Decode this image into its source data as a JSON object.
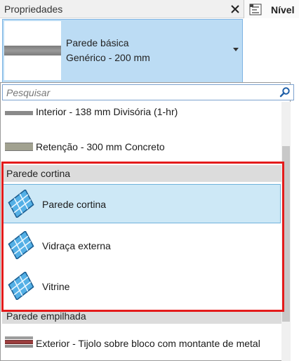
{
  "panel": {
    "title": "Propriedades",
    "close_icon": "close-icon"
  },
  "right_panel": {
    "label": "Nível",
    "icon": "level-icon"
  },
  "type_selector": {
    "family": "Parede básica",
    "type": "Genérico - 200 mm",
    "icon": "chevron-down-icon"
  },
  "search": {
    "placeholder": "Pesquisar",
    "value": "",
    "icon": "search-icon"
  },
  "list": {
    "ungrouped_items": [
      {
        "label": "Interior - 138 mm Divisória (1-hr)",
        "swatch_color": "#8a8a8a"
      },
      {
        "label": "Retenção - 300 mm Concreto",
        "swatch_color": "#9d9d8f"
      }
    ],
    "groups": [
      {
        "header": "Parede cortina",
        "items": [
          {
            "label": "Parede cortina",
            "selected": true,
            "icon": "curtain-wall-icon"
          },
          {
            "label": "Vidraça externa",
            "selected": false,
            "icon": "curtain-wall-icon"
          },
          {
            "label": "Vitrine",
            "selected": false,
            "icon": "curtain-wall-icon"
          }
        ]
      },
      {
        "header": "Parede empilhada",
        "items": [
          {
            "label": "Exterior - Tijolo sobre bloco com montante de metal",
            "selected": false,
            "icon": "stacked-wall-icon"
          }
        ]
      }
    ]
  },
  "colors": {
    "selector_bg": "#bcdcf4",
    "selected_row_bg": "#cde8f6",
    "highlight_border": "#e41b1b",
    "group_header_bg": "#dcdcdc"
  }
}
